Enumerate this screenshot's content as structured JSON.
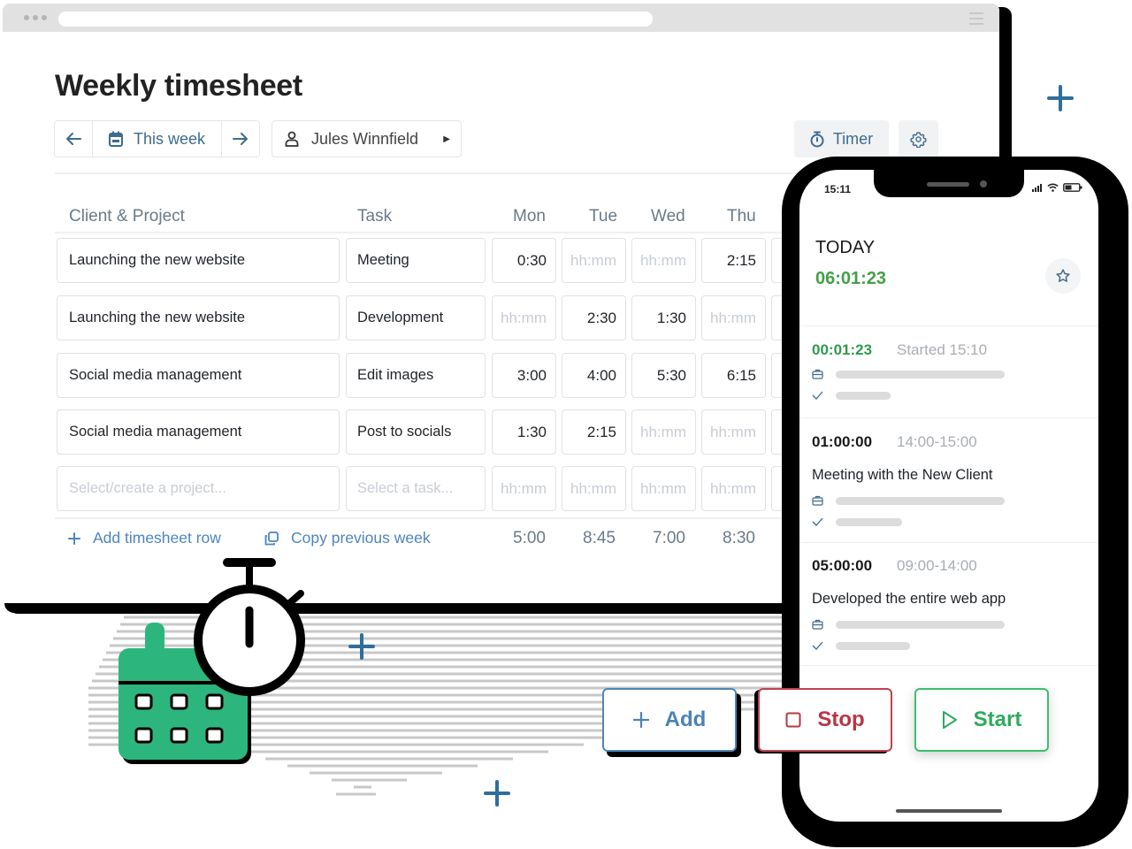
{
  "page": {
    "title": "Weekly timesheet"
  },
  "toolbar": {
    "prev_week": "previous",
    "week_label": "This week",
    "next_week": "next",
    "user_name": "Jules Winnfield",
    "timer_label": "Timer"
  },
  "table": {
    "headers": {
      "project": "Client & Project",
      "task": "Task",
      "days": [
        "Mon",
        "Tue",
        "Wed",
        "Thu"
      ]
    },
    "time_placeholder": "hh:mm",
    "rows": [
      {
        "project": "Launching the new website",
        "task": "Meeting",
        "times": [
          "0:30",
          "",
          "",
          "2:15"
        ]
      },
      {
        "project": "Launching the new website",
        "task": "Development",
        "times": [
          "",
          "2:30",
          "1:30",
          ""
        ]
      },
      {
        "project": "Social media management",
        "task": "Edit images",
        "times": [
          "3:00",
          "4:00",
          "5:30",
          "6:15"
        ]
      },
      {
        "project": "Social media management",
        "task": "Post to socials",
        "times": [
          "1:30",
          "2:15",
          "",
          ""
        ]
      }
    ],
    "new_row": {
      "project_placeholder": "Select/create a project...",
      "task_placeholder": "Select a task..."
    },
    "totals": [
      "5:00",
      "8:45",
      "7:00",
      "8:30"
    ],
    "add_row_label": "Add timesheet row",
    "copy_week_label": "Copy previous week"
  },
  "phone": {
    "status_time": "15:11",
    "today_label": "TODAY",
    "today_total": "06:01:23",
    "entries": [
      {
        "duration": "00:01:23",
        "range": "Started 15:10",
        "description": "",
        "running": true
      },
      {
        "duration": "01:00:00",
        "range": "14:00-15:00",
        "description": "Meeting with the New Client",
        "running": false
      },
      {
        "duration": "05:00:00",
        "range": "09:00-14:00",
        "description": "Developed the entire web app",
        "running": false
      }
    ]
  },
  "actions": {
    "add_label": "Add",
    "stop_label": "Stop",
    "start_label": "Start"
  },
  "colors": {
    "accent_blue": "#3e6b8e",
    "link_blue": "#4b86bf",
    "running_green": "#43a047",
    "stop_red": "#b83545",
    "start_green": "#2eab5c",
    "calendar_green": "#2db57e"
  }
}
